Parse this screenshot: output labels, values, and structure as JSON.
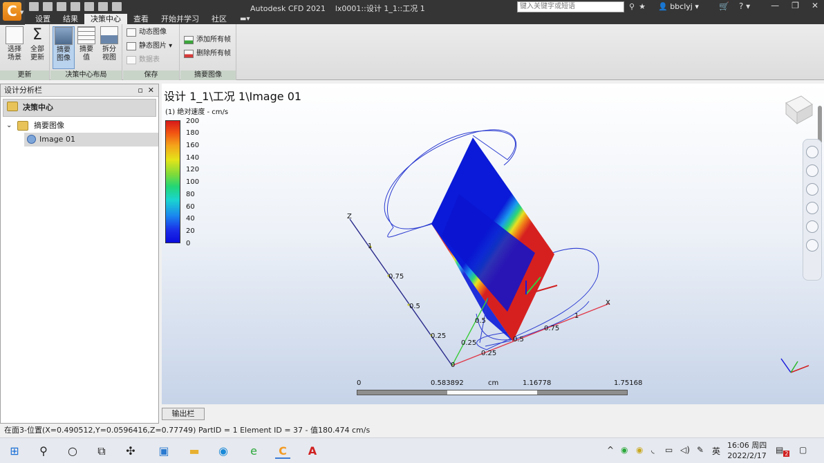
{
  "titlebar": {
    "app_title": "Autodesk CFD 2021",
    "document": "lx0001::设计 1_1::工况 1",
    "search_placeholder": "键入关键字或短语",
    "user": "bbclyj"
  },
  "tabs": [
    {
      "label": "设置"
    },
    {
      "label": "结果"
    },
    {
      "label": "决策中心",
      "active": true
    },
    {
      "label": "查看"
    },
    {
      "label": "开始并学习"
    },
    {
      "label": "社区"
    }
  ],
  "ribbon": {
    "groups": {
      "update": {
        "label": "更新",
        "select_scene": [
          "选择",
          "场景"
        ],
        "update_all": [
          "全部",
          "更新"
        ]
      },
      "layout": {
        "label": "决策中心布局",
        "summary_image": [
          "摘要",
          "图像"
        ],
        "summary_value": [
          "摘要",
          "值"
        ],
        "split_view": [
          "拆分",
          "视图"
        ]
      },
      "save": {
        "label": "保存",
        "dynamic_image": "动态图像",
        "static_image": "静态图片",
        "data_table": "数据表"
      },
      "summary": {
        "label": "摘要图像",
        "add_all_frames": "添加所有帧",
        "delete_all_frames": "删除所有帧"
      }
    }
  },
  "left_panel": {
    "title": "设计分析栏",
    "root": "决策中心",
    "child": "摘要图像",
    "leaf": "Image 01"
  },
  "view": {
    "title": "设计 1_1\\工况 1\\Image 01",
    "legend_title": "(1) 绝对速度 - cm/s",
    "legend_ticks": [
      "200",
      "180",
      "160",
      "140",
      "120",
      "100",
      "80",
      "60",
      "40",
      "20",
      "0"
    ],
    "axis_labels": {
      "x": "X",
      "z": "Z"
    },
    "axis_ticks": {
      "z": [
        "1",
        "0.75",
        "0.5",
        "0.25"
      ],
      "x": [
        "0.25",
        "0.5",
        "0.75",
        "1"
      ],
      "y": [
        "0.25",
        "0.5"
      ],
      "origin": "0"
    },
    "scale": {
      "labels": [
        "0",
        "0.583892",
        "cm",
        "1.16778",
        "1.75168"
      ]
    }
  },
  "output_tab": "输出栏",
  "status_text": "在面3-位置(X=0.490512,Y=0.0596416,Z=0.77749) PartID = 1 Element ID = 37 - 值180.474  cm/s",
  "taskbar": {
    "ime": "英",
    "time": "16:06 周四",
    "date": "2022/2/17",
    "notification_count": "2"
  },
  "colors": {
    "titlebar": "#353535",
    "ribbon_group_label": "#c9d4c9",
    "selected_button": "#b9d2ee",
    "app_orange": "#f39a22"
  }
}
